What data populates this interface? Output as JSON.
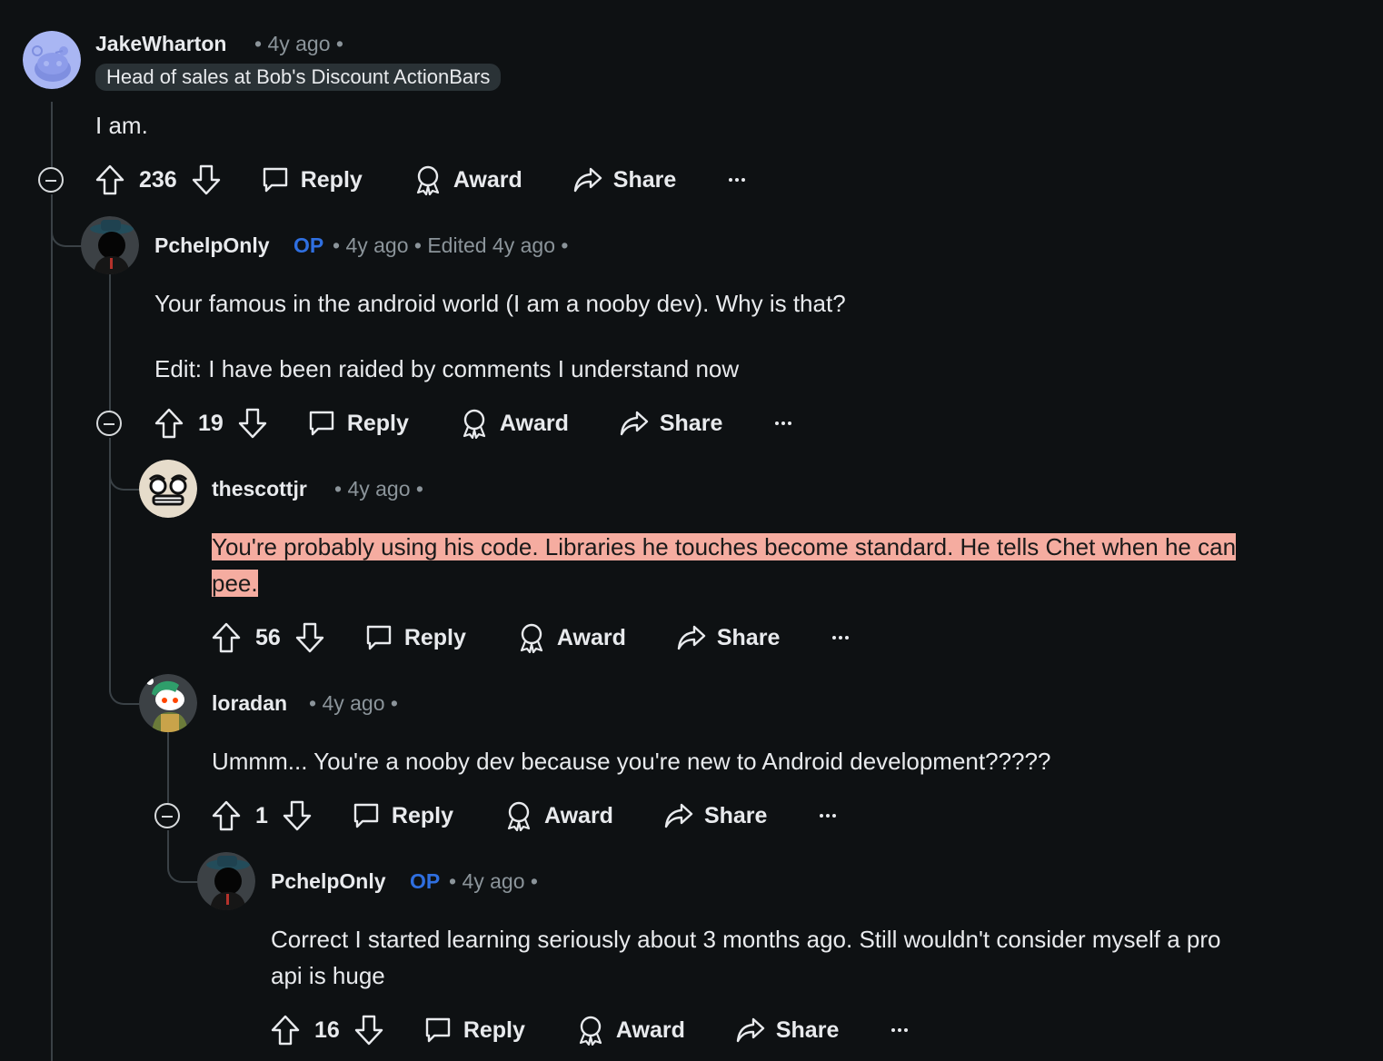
{
  "comments": [
    {
      "username": "JakeWharton",
      "meta": "• 4y ago •",
      "flair": "Head of sales at Bob's Discount ActionBars",
      "body": "I am.",
      "votes": "236",
      "reply": "Reply",
      "award": "Award",
      "share": "Share"
    },
    {
      "username": "PchelpOnly",
      "op": "OP",
      "meta": "• 4y ago • Edited 4y ago •",
      "body_1": "Your famous in the android world (I am a nooby dev). Why is that?",
      "body_2": "Edit: I have been raided by comments I understand now",
      "votes": "19",
      "reply": "Reply",
      "award": "Award",
      "share": "Share"
    },
    {
      "username": "thescottjr",
      "meta": "• 4y ago •",
      "body_1": "You're probably using his code. Libraries he touches become standard. He tells Chet when he can",
      "body_2": "pee.",
      "votes": "56",
      "reply": "Reply",
      "award": "Award",
      "share": "Share"
    },
    {
      "username": "loradan",
      "meta": "• 4y ago •",
      "body": "Ummm... You're a nooby dev because you're new to Android development?????",
      "votes": "1",
      "reply": "Reply",
      "award": "Award",
      "share": "Share"
    },
    {
      "username": "PchelpOnly",
      "op": "OP",
      "meta": "• 4y ago •",
      "body_1": "Correct I started learning seriously about 3 months ago. Still wouldn't consider myself a pro",
      "body_2": "api is huge",
      "votes": "16",
      "reply": "Reply",
      "award": "Award",
      "share": "Share"
    }
  ],
  "colors": {
    "background": "#0e1113",
    "op_badge": "#2f6fe0",
    "highlight": "#f5aca0",
    "thread_line": "#3a4146"
  }
}
